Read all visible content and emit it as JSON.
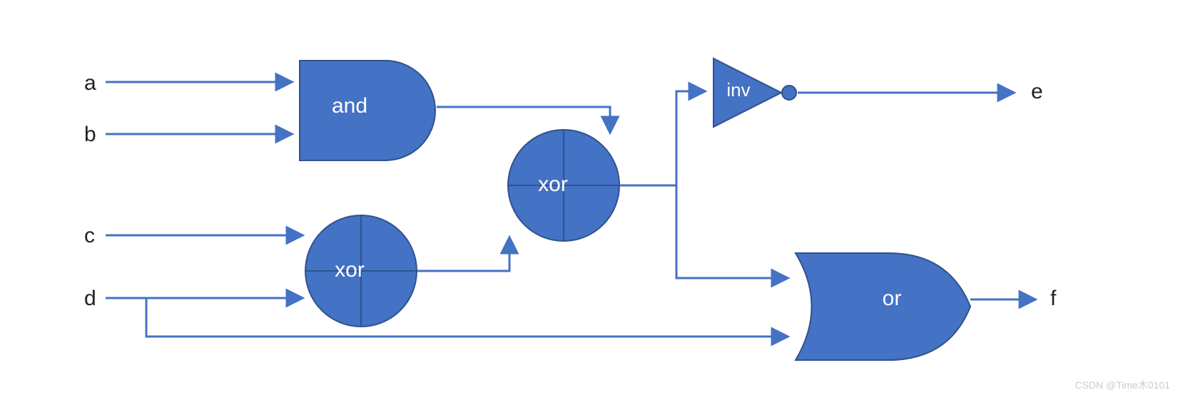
{
  "inputs": {
    "a": "a",
    "b": "b",
    "c": "c",
    "d": "d"
  },
  "outputs": {
    "e": "e",
    "f": "f"
  },
  "gates": {
    "and": "and",
    "xor1": "xor",
    "xor2": "xor",
    "inv": "inv",
    "or": "or"
  },
  "watermark": "CSDN @Time木0101"
}
